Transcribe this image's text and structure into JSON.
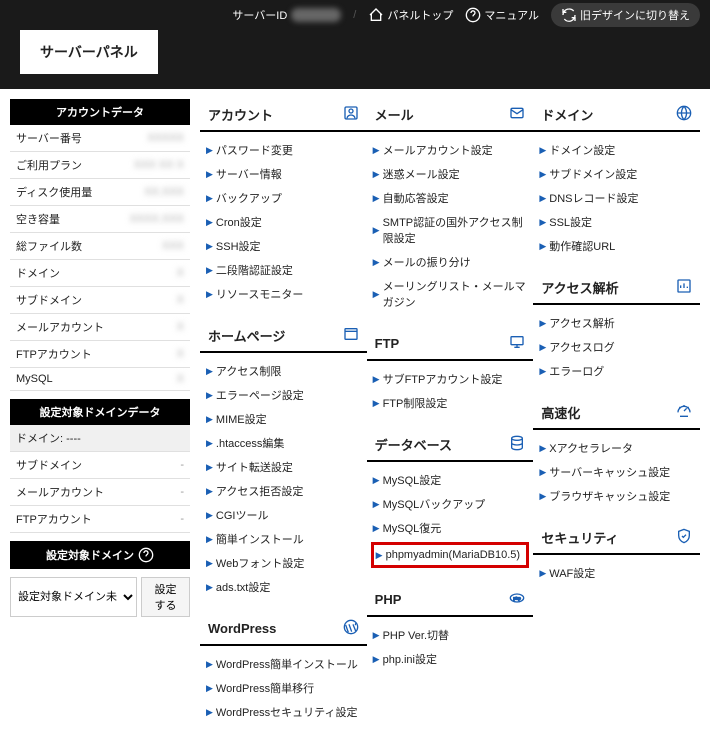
{
  "topbar": {
    "server_id_label": "サーバーID",
    "panel_top": "パネルトップ",
    "manual": "マニュアル",
    "old_design": "旧デザインに切り替え"
  },
  "logo": "サーバーパネル",
  "sidebar": {
    "account_header": "アカウントデータ",
    "rows": [
      {
        "label": "サーバー番号",
        "value": "XXXXX"
      },
      {
        "label": "ご利用プラン",
        "value": "XXX XX X"
      },
      {
        "label": "ディスク使用量",
        "value": "XX.XXX"
      },
      {
        "label": "空き容量",
        "value": "XXXX.XXX"
      },
      {
        "label": "総ファイル数",
        "value": "XXX"
      },
      {
        "label": "ドメイン",
        "value": "X"
      },
      {
        "label": "サブドメイン",
        "value": "X"
      },
      {
        "label": "メールアカウント",
        "value": "X"
      },
      {
        "label": "FTPアカウント",
        "value": "X"
      },
      {
        "label": "MySQL",
        "value": "X"
      }
    ],
    "domain_data_header": "設定対象ドメインデータ",
    "domain_label": "ドメイン: ----",
    "domain_rows": [
      {
        "label": "サブドメイン",
        "value": "-"
      },
      {
        "label": "メールアカウント",
        "value": "-"
      },
      {
        "label": "FTPアカウント",
        "value": "-"
      }
    ],
    "target_domain_header": "設定対象ドメイン",
    "select_placeholder": "設定対象ドメイン未",
    "set_button": "設定する"
  },
  "panels": [
    {
      "title": "アカウント",
      "icon": "user",
      "items": [
        "パスワード変更",
        "サーバー情報",
        "バックアップ",
        "Cron設定",
        "SSH設定",
        "二段階認証設定",
        "リソースモニター"
      ]
    },
    {
      "title": "メール",
      "icon": "mail",
      "items": [
        "メールアカウント設定",
        "迷惑メール設定",
        "自動応答設定",
        "SMTP認証の国外アクセス制限設定",
        "メールの振り分け",
        "メーリングリスト・メールマガジン"
      ]
    },
    {
      "title": "ドメイン",
      "icon": "globe",
      "items": [
        "ドメイン設定",
        "サブドメイン設定",
        "DNSレコード設定",
        "SSL設定",
        "動作確認URL"
      ]
    },
    {
      "title": "ホームページ",
      "icon": "window",
      "items": [
        "アクセス制限",
        "エラーページ設定",
        "MIME設定",
        ".htaccess編集",
        "サイト転送設定",
        "アクセス拒否設定",
        "CGIツール",
        "簡単インストール",
        "Webフォント設定",
        "ads.txt設定"
      ]
    },
    {
      "title": "FTP",
      "icon": "monitor",
      "items": [
        "サブFTPアカウント設定",
        "FTP制限設定"
      ]
    },
    {
      "title": "アクセス解析",
      "icon": "chart",
      "items": [
        "アクセス解析",
        "アクセスログ",
        "エラーログ"
      ]
    },
    {
      "title": "データベース",
      "icon": "db",
      "items": [
        "MySQL設定",
        "MySQLバックアップ",
        "MySQL復元",
        "phpmyadmin(MariaDB10.5)"
      ],
      "highlight": 3
    },
    {
      "title": "高速化",
      "icon": "speed",
      "items": [
        "Xアクセラレータ",
        "サーバーキャッシュ設定",
        "ブラウザキャッシュ設定"
      ]
    },
    {
      "title": "PHP",
      "icon": "php",
      "items": [
        "PHP Ver.切替",
        "php.ini設定"
      ]
    },
    {
      "title": "セキュリティ",
      "icon": "shield",
      "items": [
        "WAF設定"
      ]
    },
    {
      "title": "WordPress",
      "icon": "wp",
      "items": [
        "WordPress簡単インストール",
        "WordPress簡単移行",
        "WordPressセキュリティ設定"
      ]
    }
  ]
}
